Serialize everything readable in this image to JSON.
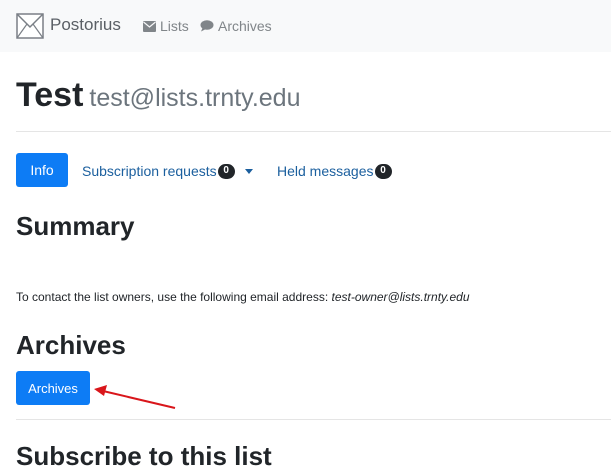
{
  "navbar": {
    "brand": "Postorius",
    "brand_icon": "envelope-icon",
    "links": [
      {
        "label": "Lists",
        "icon": "envelope-icon"
      },
      {
        "label": "Archives",
        "icon": "comment-icon"
      }
    ]
  },
  "list": {
    "name": "Test",
    "address": "test@lists.trnty.edu"
  },
  "tabs": {
    "info": "Info",
    "subscription_requests": {
      "label": "Subscription requests",
      "count": "0"
    },
    "held_messages": {
      "label": "Held messages",
      "count": "0"
    }
  },
  "summary": {
    "heading": "Summary",
    "contact_text": "To contact the list owners, use the following email address:",
    "owner_email": "test-owner@lists.trnty.edu"
  },
  "archives": {
    "heading": "Archives",
    "button_label": "Archives"
  },
  "subscribe": {
    "heading": "Subscribe to this list"
  },
  "colors": {
    "primary": "#0d7cf5",
    "annotation_arrow": "#d9161b"
  }
}
